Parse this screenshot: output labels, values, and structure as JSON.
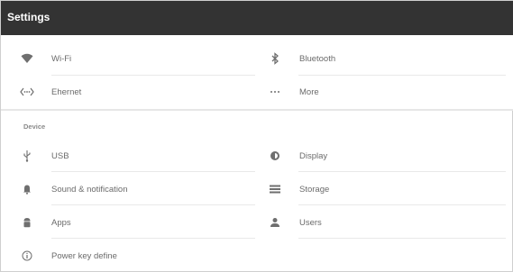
{
  "appbar": {
    "title": "Settings"
  },
  "wireless": {
    "items": [
      {
        "label": "Wi-Fi",
        "icon": "wifi-icon"
      },
      {
        "label": "Bluetooth",
        "icon": "bluetooth-icon"
      },
      {
        "label": "Ehernet",
        "icon": "ethernet-icon"
      },
      {
        "label": "More",
        "icon": "more-icon"
      }
    ]
  },
  "device": {
    "header": "Device",
    "items": [
      {
        "label": "USB",
        "icon": "usb-icon"
      },
      {
        "label": "Display",
        "icon": "display-icon"
      },
      {
        "label": "Sound & notification",
        "icon": "bell-icon"
      },
      {
        "label": "Storage",
        "icon": "storage-icon"
      },
      {
        "label": "Apps",
        "icon": "android-icon"
      },
      {
        "label": "Users",
        "icon": "user-icon"
      },
      {
        "label": "Power key define",
        "icon": "info-icon"
      }
    ]
  }
}
